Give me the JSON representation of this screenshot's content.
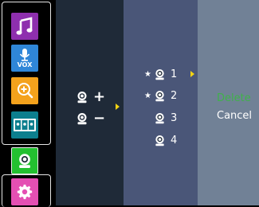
{
  "sidebar": {
    "items": [
      {
        "name": "music",
        "icon": "music-note-icon",
        "color": "#8e2fae"
      },
      {
        "name": "vox",
        "icon": "microphone-icon",
        "label": "VOX",
        "color": "#2f86d8"
      },
      {
        "name": "zoom",
        "icon": "zoom-in-icon",
        "color": "#f4a21c"
      },
      {
        "name": "display",
        "icon": "display-icon",
        "color": "#0c7f8e"
      },
      {
        "name": "camera",
        "icon": "camera-icon",
        "color": "#23c030",
        "selected": true
      },
      {
        "name": "settings",
        "icon": "gear-icon",
        "color": "#e44fb3"
      }
    ]
  },
  "camera_menu": {
    "add_symbol": "+",
    "remove_symbol": "−"
  },
  "camera_list": {
    "items": [
      {
        "number": "1",
        "star": "★"
      },
      {
        "number": "2",
        "star": "★"
      },
      {
        "number": "3",
        "star": ""
      },
      {
        "number": "4",
        "star": ""
      }
    ]
  },
  "actions": {
    "delete_label": "Delete",
    "cancel_label": "Cancel"
  },
  "colors": {
    "pointer": "#f2d313",
    "delete_text": "#3fb24a",
    "panel1": "#1f2a38",
    "panel2": "#4a5678",
    "panel3": "#718196"
  }
}
